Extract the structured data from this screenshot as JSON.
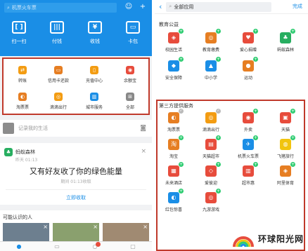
{
  "left": {
    "search_placeholder": "机票火车票",
    "quick_actions": [
      {
        "label": "扫一扫",
        "icon": "scan-icon",
        "glyph": "[ ]"
      },
      {
        "label": "付钱",
        "icon": "barcode-icon",
        "glyph": "|||"
      },
      {
        "label": "收钱",
        "icon": "yuan-icon",
        "glyph": "¥"
      },
      {
        "label": "卡包",
        "icon": "card-icon",
        "glyph": "▭"
      }
    ],
    "grid": [
      {
        "label": "转账",
        "icon": "transfer-icon",
        "glyph": "⇄",
        "color": "#f39c12"
      },
      {
        "label": "信用卡还款",
        "icon": "credit-card-icon",
        "glyph": "▭",
        "color": "#e67e22"
      },
      {
        "label": "充值中心",
        "icon": "phone-icon",
        "glyph": "▯",
        "color": "#f39c12"
      },
      {
        "label": "余额宝",
        "icon": "yuebao-icon",
        "glyph": "◉",
        "color": "#e74c3c"
      },
      {
        "label": "淘票票",
        "icon": "ticket-icon",
        "glyph": "◐",
        "color": "#e67e22"
      },
      {
        "label": "滴滴出行",
        "icon": "didi-icon",
        "glyph": "◎",
        "color": "#f39c12"
      },
      {
        "label": "城市服务",
        "icon": "city-icon",
        "glyph": "▥",
        "color": "#1a8ee6"
      },
      {
        "label": "全部",
        "icon": "all-icon",
        "glyph": "⊞",
        "color": "#888"
      }
    ],
    "feed_prompt": "记录我的生活",
    "card": {
      "title": "蚂蚁森林",
      "subtitle": "昨天 01:13",
      "message": "又有好友收了你的绿色能量",
      "date": "期间 01:13收取",
      "link": "立即收取"
    },
    "people_title": "可能认识的人"
  },
  "right": {
    "search_value": "全部应用",
    "done_label": "完成",
    "section1": "教育公益",
    "section1_items": [
      {
        "label": "校园生活",
        "icon": "campus-icon",
        "glyph": "◈",
        "color": "#e74c3c",
        "mark": "plus"
      },
      {
        "label": "教育缴费",
        "icon": "education-icon",
        "glyph": "◎",
        "color": "#e67e22",
        "mark": "plus"
      },
      {
        "label": "爱心捐赠",
        "icon": "heart-icon",
        "glyph": "♥",
        "color": "#e74c3c",
        "mark": "plus"
      },
      {
        "label": "蚂蚁森林",
        "icon": "forest-icon",
        "glyph": "♣",
        "color": "#27ae60",
        "mark": "plus"
      },
      {
        "label": "安全保障",
        "icon": "shield-icon",
        "glyph": "◆",
        "color": "#1a8ee6",
        "mark": "plus"
      },
      {
        "label": "中小学",
        "icon": "school-icon",
        "glyph": "▲",
        "color": "#1a8ee6",
        "mark": "plus"
      },
      {
        "label": "运动",
        "icon": "sport-icon",
        "glyph": "●",
        "color": "#e67e22",
        "mark": "plus"
      }
    ],
    "section2": "第三方提供服务",
    "section2_items": [
      {
        "label": "淘票票",
        "icon": "ticket-icon",
        "glyph": "◐",
        "color": "#e67e22",
        "mark": "check"
      },
      {
        "label": "滴滴出行",
        "icon": "didi-icon",
        "glyph": "◎",
        "color": "#f39c12",
        "mark": "check"
      },
      {
        "label": "外卖",
        "icon": "takeout-icon",
        "glyph": "◉",
        "color": "#e74c3c",
        "mark": "plus"
      },
      {
        "label": "天猫",
        "icon": "tmall-icon",
        "glyph": "▣",
        "color": "#e74c3c",
        "mark": "plus"
      },
      {
        "label": "淘宝",
        "icon": "taobao-icon",
        "glyph": "淘",
        "color": "#e67e22",
        "mark": "plus"
      },
      {
        "label": "天猫超市",
        "icon": "tmall-market-icon",
        "glyph": "▤",
        "color": "#e74c3c",
        "mark": "plus"
      },
      {
        "label": "机票火车票",
        "icon": "plane-icon",
        "glyph": "✈",
        "color": "#1a8ee6",
        "mark": "plus"
      },
      {
        "label": "飞猪旅行",
        "icon": "fliggy-icon",
        "glyph": "◍",
        "color": "#f1c40f",
        "mark": "plus"
      },
      {
        "label": "未来酒店",
        "icon": "hotel-icon",
        "glyph": "▦",
        "color": "#e74c3c",
        "mark": "plus"
      },
      {
        "label": "爱彼迎",
        "icon": "airbnb-icon",
        "glyph": "◇",
        "color": "#e74c3c",
        "mark": "plus"
      },
      {
        "label": "超市惠",
        "icon": "market-icon",
        "glyph": "▥",
        "color": "#e74c3c",
        "mark": "plus"
      },
      {
        "label": "阿里体育",
        "icon": "ali-sports-icon",
        "glyph": "◈",
        "color": "#e67e22",
        "mark": "plus"
      },
      {
        "label": "红包惊喜",
        "icon": "red-packet-icon",
        "glyph": "◐",
        "color": "#1a8ee6",
        "mark": "plus"
      },
      {
        "label": "九游游戏",
        "icon": "game-icon",
        "glyph": "◎",
        "color": "#e74c3c",
        "mark": "plus"
      }
    ]
  },
  "watermark": "环球阳光网"
}
